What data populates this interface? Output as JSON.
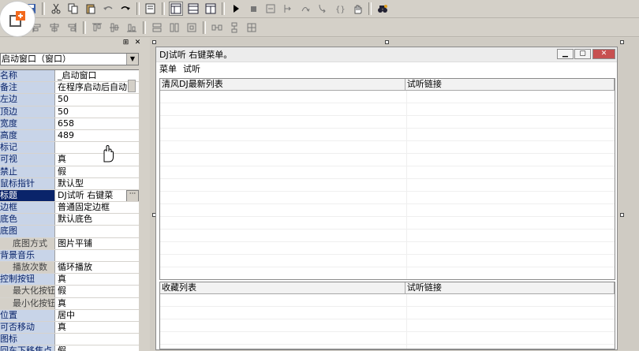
{
  "toolbar1": {
    "buttons": [
      "save-icon",
      "cut-icon",
      "copy-icon",
      "paste-icon",
      "undo-icon",
      "redo-icon",
      "find-icon",
      "layout1-icon",
      "layout2-icon",
      "layout3-icon",
      "run-icon",
      "stop-icon",
      "step-icon",
      "step-into-icon",
      "step-over-icon",
      "step-out-icon",
      "run-to-cursor-icon",
      "hand-icon",
      "search-binoculars-icon"
    ]
  },
  "toolbar2": {
    "buttons": [
      "align-left-icon",
      "align-center-icon",
      "align-right-icon",
      "align-top-icon",
      "align-middle-icon",
      "align-bottom-icon",
      "same-width-icon",
      "same-height-icon",
      "same-size-icon",
      "h-spacing-icon",
      "v-spacing-icon",
      "center-icon"
    ]
  },
  "properties": {
    "object_selector": "启动窗口（窗口）",
    "rows": [
      {
        "name": "名称",
        "value": "_启动窗口",
        "kind": "normal"
      },
      {
        "name": "备注",
        "value": "在程序启动后自动",
        "kind": "normal"
      },
      {
        "name": "左边",
        "value": "50",
        "kind": "normal"
      },
      {
        "name": "顶边",
        "value": "50",
        "kind": "normal"
      },
      {
        "name": "宽度",
        "value": "658",
        "kind": "normal"
      },
      {
        "name": "高度",
        "value": "489",
        "kind": "normal"
      },
      {
        "name": "标记",
        "value": "",
        "kind": "normal"
      },
      {
        "name": "可视",
        "value": "真",
        "kind": "normal"
      },
      {
        "name": "禁止",
        "value": "假",
        "kind": "normal"
      },
      {
        "name": "鼠标指针",
        "value": "默认型",
        "kind": "normal"
      },
      {
        "name": "标题",
        "value": "DJ试听 右键菜",
        "kind": "selected"
      },
      {
        "name": "边框",
        "value": "普通固定边框",
        "kind": "normal"
      },
      {
        "name": "底色",
        "value": "默认底色",
        "kind": "normal"
      },
      {
        "name": "底图",
        "value": "",
        "kind": "normal"
      },
      {
        "name": "底图方式",
        "value": "图片平铺",
        "kind": "sub"
      },
      {
        "name": "背景音乐",
        "value": "",
        "kind": "normal"
      },
      {
        "name": "播放次数",
        "value": "循环播放",
        "kind": "sub"
      },
      {
        "name": "控制按钮",
        "value": "真",
        "kind": "normal"
      },
      {
        "name": "最大化按钮",
        "value": "假",
        "kind": "sub"
      },
      {
        "name": "最小化按钮",
        "value": "真",
        "kind": "sub"
      },
      {
        "name": "位置",
        "value": "居中",
        "kind": "normal"
      },
      {
        "name": "可否移动",
        "value": "真",
        "kind": "normal"
      },
      {
        "name": "图标",
        "value": "",
        "kind": "normal"
      },
      {
        "name": "回车下移焦点",
        "value": "假",
        "kind": "normal"
      }
    ]
  },
  "form": {
    "title": "DJ试听 右键菜单。",
    "menu": [
      "菜单",
      "试听"
    ],
    "list1": {
      "columns": [
        "清风DJ最新列表",
        "试听链接"
      ]
    },
    "list2": {
      "columns": [
        "收藏列表",
        "试听链接"
      ]
    }
  },
  "colors": {
    "selected_row": "#0a246a",
    "property_name_bg": "#c8d4e8",
    "close_button": "#c75050"
  }
}
